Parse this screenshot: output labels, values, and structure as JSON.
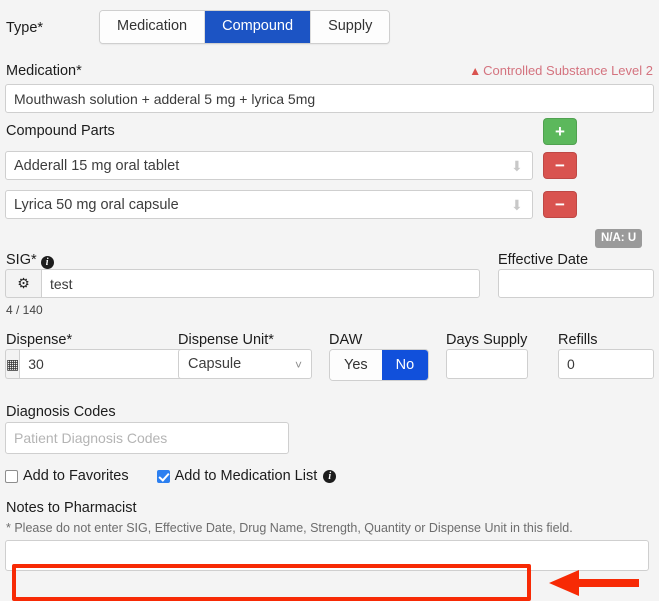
{
  "type_field": {
    "label": "Type*",
    "tabs": [
      {
        "label": "Medication",
        "active": false
      },
      {
        "label": "Compound",
        "active": true
      },
      {
        "label": "Supply",
        "active": false
      }
    ]
  },
  "medication": {
    "label": "Medication*",
    "warning": "Controlled Substance Level 2",
    "warning_icon": "warning-triangle-icon",
    "warning_color": "#d4737f",
    "value": "Mouthwash solution + adderal 5 mg + lyrica 5mg"
  },
  "compound_parts": {
    "label": "Compound Parts",
    "add_label": "+",
    "remove_label": "−",
    "add_color": "#5cb85c",
    "remove_color": "#d9534f",
    "parts": [
      {
        "value": "Adderall 15 mg oral tablet"
      },
      {
        "value": "Lyrica 50 mg oral capsule"
      }
    ]
  },
  "na_badge": {
    "label": "N/A: U",
    "color": "#9a9a9a"
  },
  "sig": {
    "label": "SIG*",
    "gear_icon": "gear-icon",
    "value": "test",
    "counter": "4 / 140"
  },
  "effective_date": {
    "label": "Effective Date",
    "value": ""
  },
  "dispense": {
    "label": "Dispense*",
    "calculator_icon": "calculator-icon",
    "value": "30"
  },
  "dispense_unit": {
    "label": "Dispense Unit*",
    "value": "Capsule",
    "options": [
      "Capsule"
    ]
  },
  "daw": {
    "label": "DAW",
    "options": [
      {
        "label": "Yes",
        "active": false
      },
      {
        "label": "No",
        "active": true
      }
    ],
    "active_color": "#1150db"
  },
  "days_supply": {
    "label": "Days Supply",
    "value": ""
  },
  "refills": {
    "label": "Refills",
    "value": "0"
  },
  "diagnosis": {
    "label": "Diagnosis Codes",
    "placeholder": "Patient Diagnosis Codes",
    "value": ""
  },
  "checkboxes": [
    {
      "label": "Add to Favorites",
      "checked": false
    },
    {
      "label": "Add to Medication List",
      "checked": true,
      "info_icon": "info-icon"
    }
  ],
  "notes": {
    "label": "Notes to Pharmacist",
    "hint": "* Please do not enter SIG, Effective Date, Drug Name, Strength, Quantity or Dispense Unit in this field.",
    "value": ""
  },
  "annotation": {
    "color": "#f72a05",
    "box_name": "highlight-box",
    "arrow_name": "pointer-arrow"
  }
}
